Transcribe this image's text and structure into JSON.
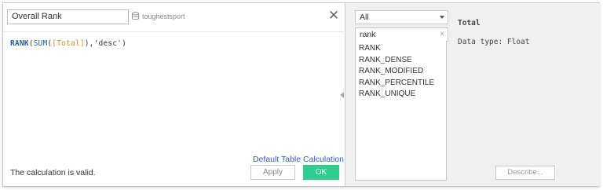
{
  "editor": {
    "calc_name": "Overall Rank",
    "datasource": "toughestsport",
    "close_symbol": "✕",
    "formula": {
      "fn_outer": "RANK",
      "open1": "(",
      "fn_inner": "SUM",
      "open2": "(",
      "field": "[Total]",
      "close_and_comma": "),",
      "string_arg": "'desc'",
      "close1": ")"
    },
    "default_table_calc_label": "Default Table Calculation",
    "status": "The calculation is valid.",
    "apply_label": "Apply",
    "ok_label": "OK"
  },
  "functions": {
    "category": "All",
    "search_value": "rank",
    "search_clear": "×",
    "items": [
      "RANK",
      "RANK_DENSE",
      "RANK_MODIFIED",
      "RANK_PERCENTILE",
      "RANK_UNIQUE"
    ],
    "info_title": "Total",
    "info_type": "Data type: Float",
    "describe_label": "Describe..."
  },
  "colors": {
    "ok_button": "#2fcc8f",
    "function_keyword": "#1f5ea8",
    "field_reference": "#e08a2a",
    "link": "#2a5fbf",
    "panel_bg": "#f0f0f0"
  }
}
